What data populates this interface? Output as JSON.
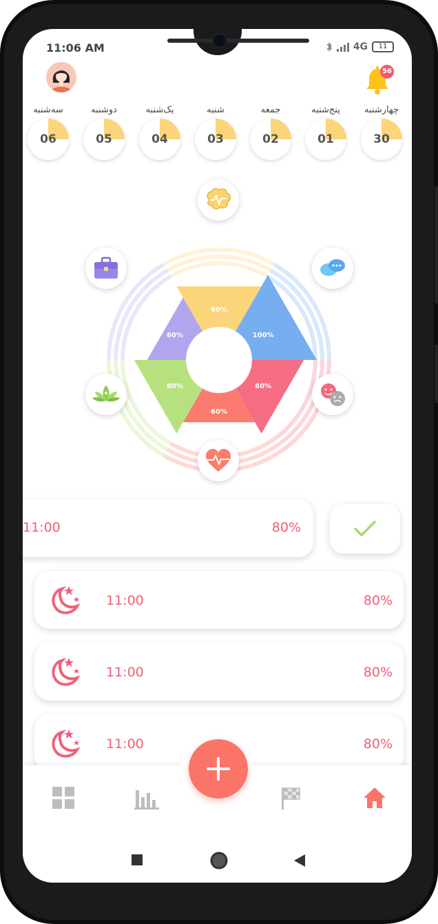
{
  "status": {
    "time": "11:06 AM",
    "network": "4G",
    "battery": "11"
  },
  "notifications": {
    "count": "56"
  },
  "days": [
    {
      "name": "سه‌شنبه",
      "num": "06"
    },
    {
      "name": "دوشنبه",
      "num": "05"
    },
    {
      "name": "یک‌شنبه",
      "num": "04"
    },
    {
      "name": "شنبه",
      "num": "03"
    },
    {
      "name": "جمعه",
      "num": "02"
    },
    {
      "name": "پنج‌شنبه",
      "num": "01"
    },
    {
      "name": "چهارشنبه",
      "num": "30"
    }
  ],
  "wheel": {
    "segments": [
      {
        "key": "mind",
        "label": "80%",
        "value": 80,
        "color": "#fbd57a",
        "icon": "brain-icon"
      },
      {
        "key": "social",
        "label": "100%",
        "value": 100,
        "color": "#77aef0",
        "icon": "chat-bubbles-icon"
      },
      {
        "key": "emotion",
        "label": "80%",
        "value": 80,
        "color": "#f56d82",
        "icon": "mood-faces-icon"
      },
      {
        "key": "health",
        "label": "60%",
        "value": 60,
        "color": "#fb7c6e",
        "icon": "heart-pulse-icon"
      },
      {
        "key": "spirit",
        "label": "80%",
        "value": 80,
        "color": "#b7e17f",
        "icon": "lotus-icon"
      },
      {
        "key": "work",
        "label": "60%",
        "value": 60,
        "color": "#b3a5ed",
        "icon": "briefcase-icon"
      }
    ]
  },
  "activities": [
    {
      "time": "11:00",
      "percent": "80%",
      "icon": "moon-stars-icon"
    },
    {
      "time": "11:00",
      "percent": "80%",
      "icon": "moon-stars-icon"
    },
    {
      "time": "11:00",
      "percent": "80%",
      "icon": "moon-stars-icon"
    },
    {
      "time": "11:00",
      "percent": "80%",
      "icon": "moon-stars-icon"
    }
  ],
  "colors": {
    "accent": "#fa7467",
    "text_accent": "#f05f74",
    "tab_inactive": "#bdbdbd"
  }
}
